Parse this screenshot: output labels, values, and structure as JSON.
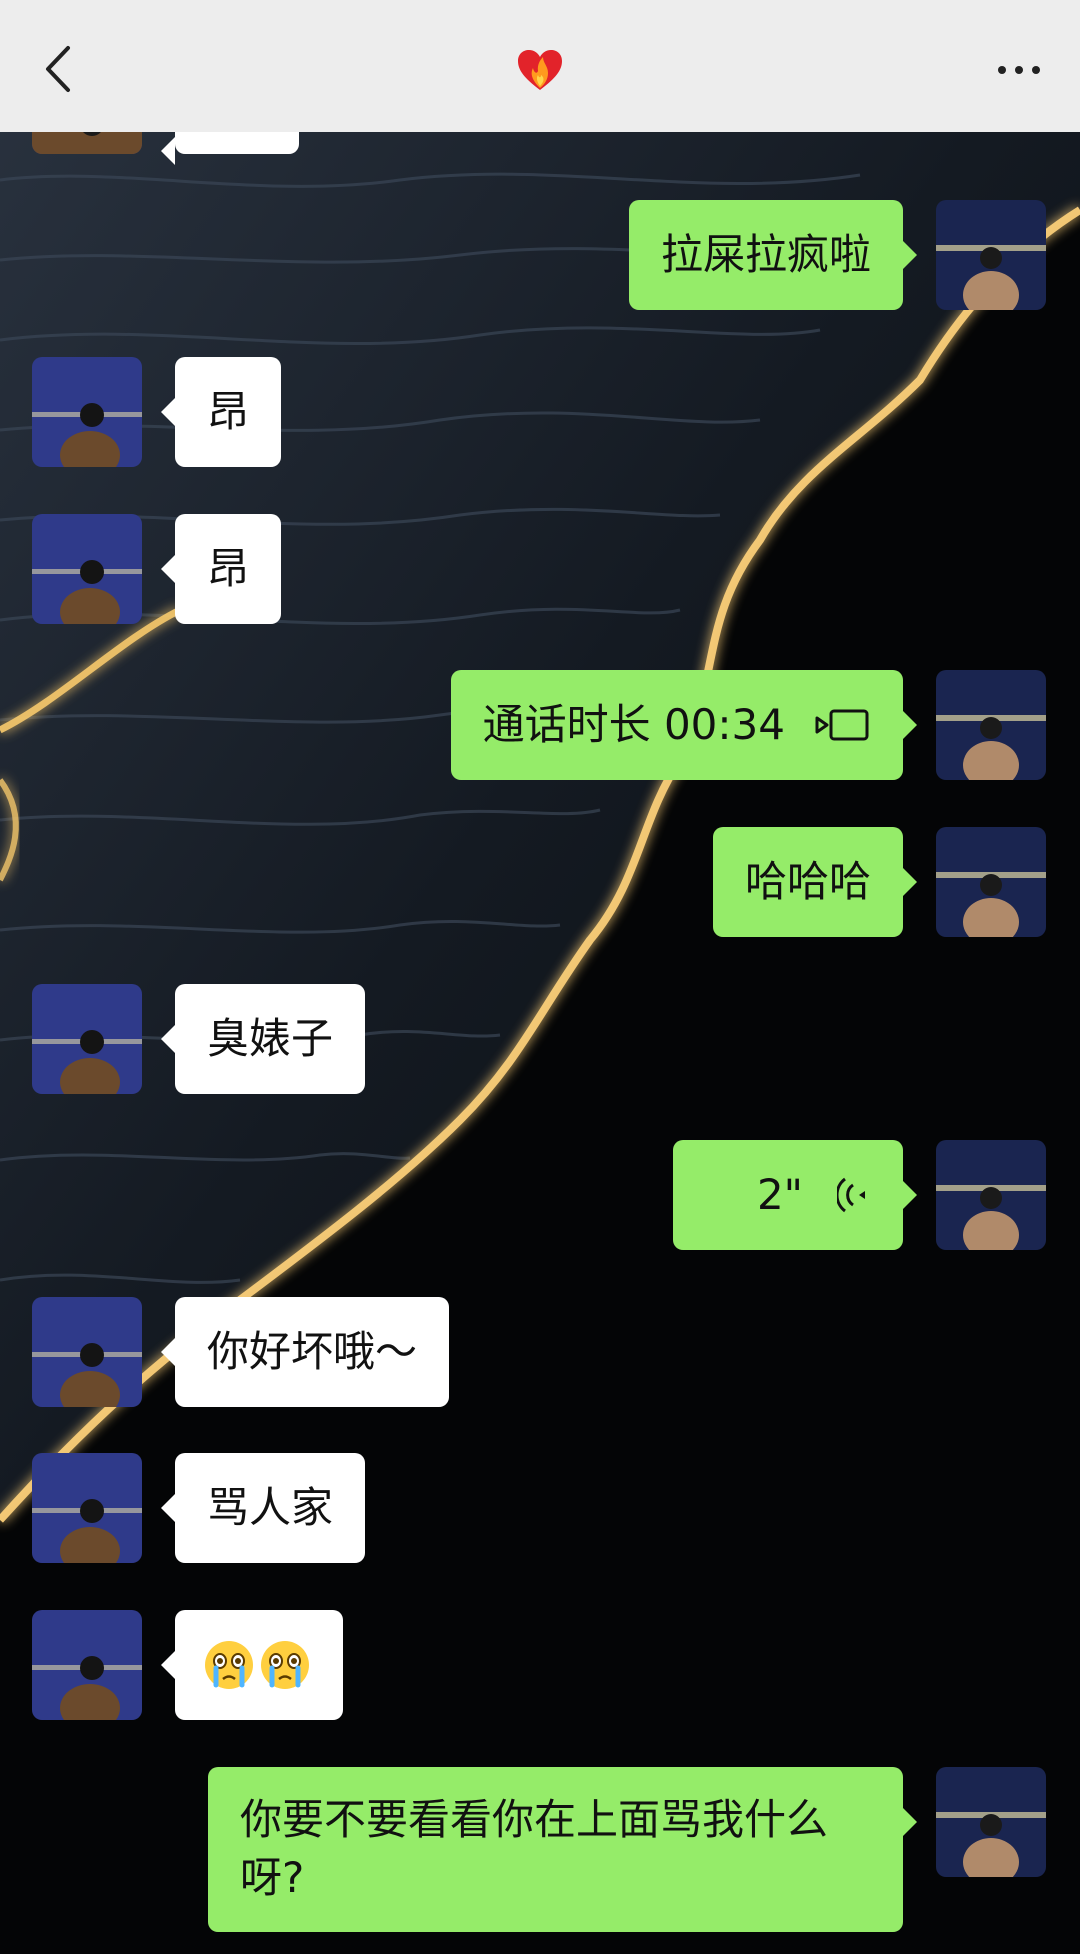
{
  "header": {
    "back_icon": "chevron-left-icon",
    "title_icon": "heart-on-fire-icon",
    "more_icon": "more-dots-icon"
  },
  "messages": [
    {
      "id": "m0",
      "side": "recv",
      "text": "",
      "partial": true
    },
    {
      "id": "m1",
      "side": "sent",
      "text": "拉屎拉疯啦"
    },
    {
      "id": "m2",
      "side": "recv",
      "text": "昂"
    },
    {
      "id": "m3",
      "side": "recv",
      "text": "昂"
    },
    {
      "id": "m4",
      "side": "sent",
      "type": "call",
      "text": "通话时长 00:34",
      "icon": "video-call-icon"
    },
    {
      "id": "m5",
      "side": "sent",
      "text": "哈哈哈"
    },
    {
      "id": "m6",
      "side": "recv",
      "text": "臭婊子"
    },
    {
      "id": "m7",
      "side": "sent",
      "type": "voice",
      "text": "2\"",
      "icon": "voice-wave-icon"
    },
    {
      "id": "m8",
      "side": "recv",
      "text": "你好坏哦～"
    },
    {
      "id": "m9",
      "side": "recv",
      "text": "骂人家"
    },
    {
      "id": "m10",
      "side": "recv",
      "type": "emoji",
      "icons": [
        "crying-face-icon",
        "crying-face-icon"
      ]
    },
    {
      "id": "m11",
      "side": "sent",
      "text": "你要不要看看你在上面骂我什么呀?"
    }
  ],
  "colors": {
    "sent_bubble": "#95ec69",
    "recv_bubble": "#ffffff",
    "topbar": "#ededed",
    "background": "#050607"
  }
}
